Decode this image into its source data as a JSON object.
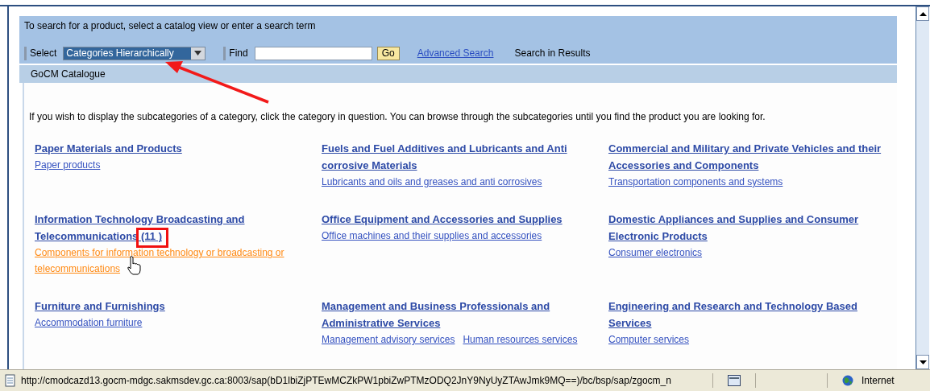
{
  "instruction": "To search for a product, select a catalog view or enter a search term",
  "toolbar": {
    "select_label": "Select",
    "select_value": "Categories Hierarchically",
    "find_label": "Find",
    "go_button": "Go",
    "advanced_search": "Advanced Search",
    "search_in_results": "Search in Results"
  },
  "breadcrumb": "GoCM Catalogue",
  "intro": "If you wish to display the subcategories of a category, click the category in question. You can browse through the subcategories until you find the product you are looking for.",
  "categories": [
    {
      "title": "Paper Materials and Products",
      "subcategories": [
        {
          "label": "Paper products",
          "hovered": false
        }
      ]
    },
    {
      "title": "Fuels and Fuel Additives and Lubricants and Anti corrosive Materials",
      "subcategories": [
        {
          "label": "Lubricants and oils and greases and anti corrosives",
          "hovered": false
        }
      ]
    },
    {
      "title": "Commercial and Military and Private Vehicles and their Accessories and Components",
      "subcategories": [
        {
          "label": "Transportation components and systems",
          "hovered": false
        }
      ]
    },
    {
      "title": "Information Technology Broadcasting and Telecommunications (11 )",
      "subcategories": [
        {
          "label": "Components for information technology or broadcasting or telecommunications",
          "hovered": true
        }
      ]
    },
    {
      "title": "Office Equipment and Accessories and Supplies",
      "subcategories": [
        {
          "label": "Office machines and their supplies and accessories",
          "hovered": false
        }
      ]
    },
    {
      "title": "Domestic Appliances and Supplies and Consumer Electronic Products",
      "subcategories": [
        {
          "label": "Consumer electronics",
          "hovered": false
        }
      ]
    },
    {
      "title": "Furniture and Furnishings",
      "subcategories": [
        {
          "label": "Accommodation furniture",
          "hovered": false
        }
      ]
    },
    {
      "title": "Management and Business Professionals and Administrative Services",
      "subcategories": [
        {
          "label": "Management advisory services",
          "hovered": false
        },
        {
          "label": "Human resources services",
          "hovered": false
        }
      ]
    },
    {
      "title": "Engineering and Research and Technology Based Services",
      "subcategories": [
        {
          "label": "Computer services",
          "hovered": false
        }
      ]
    }
  ],
  "status_bar": {
    "url": "http://cmodcazd13.gocm-mdgc.sakmsdev.gc.ca:8003/sap(bD1lbiZjPTEwMCZkPW1pbiZwPTMzODQ2JnY9NyUyZTAwJmk9MQ==)/bc/bsp/sap/zgocm_n",
    "zone": "Internet"
  }
}
